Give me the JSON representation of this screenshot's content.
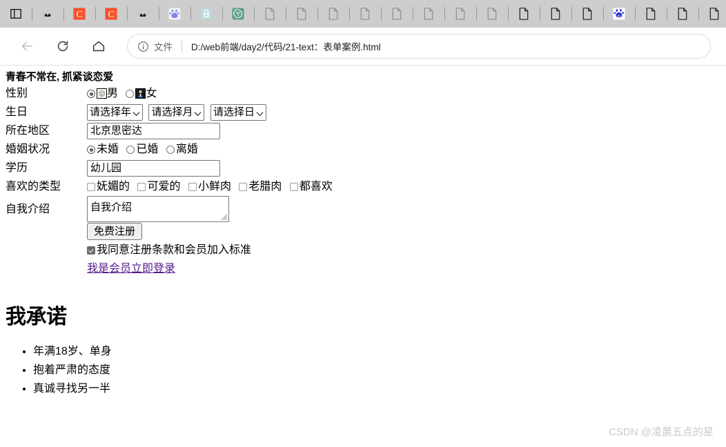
{
  "browser": {
    "tabs": [
      {
        "name": "tab-panel-toggle",
        "icon": "panel-icon",
        "type": "panel"
      },
      {
        "name": "tab-csdn-1",
        "icon": "crown-icon",
        "type": "crown"
      },
      {
        "name": "tab-c-1",
        "icon": "c-logo-icon",
        "type": "c"
      },
      {
        "name": "tab-c-2",
        "icon": "c-logo-icon",
        "type": "c"
      },
      {
        "name": "tab-csdn-2",
        "icon": "crown-icon",
        "type": "crown"
      },
      {
        "name": "tab-baidu-1",
        "icon": "baidu-paw-icon",
        "type": "baidu-light"
      },
      {
        "name": "tab-lock",
        "icon": "lock-icon",
        "type": "lock"
      },
      {
        "name": "tab-chatgpt",
        "icon": "chatgpt-icon",
        "type": "chatgpt"
      },
      {
        "name": "tab-file-1",
        "icon": "page-icon",
        "type": "page-gray"
      },
      {
        "name": "tab-file-2",
        "icon": "page-icon",
        "type": "page-gray"
      },
      {
        "name": "tab-file-3",
        "icon": "page-icon",
        "type": "page-gray"
      },
      {
        "name": "tab-file-4",
        "icon": "page-icon",
        "type": "page-gray"
      },
      {
        "name": "tab-file-5",
        "icon": "page-icon",
        "type": "page-gray"
      },
      {
        "name": "tab-file-6",
        "icon": "page-icon",
        "type": "page-gray"
      },
      {
        "name": "tab-file-7",
        "icon": "page-icon",
        "type": "page-gray"
      },
      {
        "name": "tab-file-8",
        "icon": "page-icon",
        "type": "page-gray"
      },
      {
        "name": "tab-file-9",
        "icon": "page-icon",
        "type": "page-dark"
      },
      {
        "name": "tab-file-10",
        "icon": "page-icon",
        "type": "page-dark"
      },
      {
        "name": "tab-file-11",
        "icon": "page-icon",
        "type": "page-dark"
      },
      {
        "name": "tab-baidu-2",
        "icon": "baidu-paw-icon",
        "type": "baidu-blue"
      },
      {
        "name": "tab-file-12",
        "icon": "page-icon",
        "type": "page-dark"
      },
      {
        "name": "tab-file-13",
        "icon": "page-icon",
        "type": "page-dark"
      },
      {
        "name": "tab-file-14",
        "icon": "page-icon",
        "type": "page-dark"
      },
      {
        "name": "tab-file-15",
        "icon": "page-icon",
        "type": "page-dark"
      }
    ],
    "nav": {
      "back_icon": "back-arrow-icon",
      "reload_icon": "reload-icon",
      "home_icon": "home-icon"
    },
    "omnibox": {
      "info_icon": "info-circle-icon",
      "scheme_label": "文件",
      "url": "D:/web前端/day2/代码/21-text：表单案例.html"
    }
  },
  "page": {
    "form_title": "青春不常在, 抓紧谈恋爱",
    "labels": {
      "gender": "性别",
      "birthday": "生日",
      "region": "所在地区",
      "marital": "婚姻状况",
      "education": "学历",
      "type_like": "喜欢的类型",
      "intro": "自我介绍"
    },
    "gender": {
      "options": [
        {
          "label": "男",
          "checked": true,
          "has_image": true
        },
        {
          "label": "女",
          "checked": false,
          "has_image": true
        }
      ]
    },
    "birthday": {
      "year": "请选择年",
      "month": "请选择月",
      "day": "请选择日"
    },
    "region": {
      "value": "北京思密达"
    },
    "marital": {
      "options": [
        {
          "label": "未婚",
          "checked": true
        },
        {
          "label": "已婚",
          "checked": false
        },
        {
          "label": "离婚",
          "checked": false
        }
      ]
    },
    "education": {
      "value": "幼儿园"
    },
    "type_like": {
      "options": [
        {
          "label": "妩媚的",
          "checked": false
        },
        {
          "label": "可爱的",
          "checked": false
        },
        {
          "label": "小鲜肉",
          "checked": false
        },
        {
          "label": "老腊肉",
          "checked": false
        },
        {
          "label": "都喜欢",
          "checked": false
        }
      ]
    },
    "intro": {
      "value": "自我介绍"
    },
    "submit_button": "免费注册",
    "agree": {
      "label": "我同意注册条款和会员加入标准",
      "checked": true
    },
    "login_link": "我是会员立即登录",
    "promise_heading": "我承诺",
    "promise_items": [
      "年满18岁、单身",
      "抱着严肃的态度",
      "真诚寻找另一半"
    ]
  },
  "watermark": "CSDN @凌晨五点的星",
  "colors": {
    "tabstrip_bg": "#cdcdcd",
    "link_visited": "#551a8b",
    "c_logo": "#f4522d",
    "baidu_blue": "#2932e1",
    "chatgpt_green": "#5f9e89",
    "watermark": "#c9c9c9"
  }
}
